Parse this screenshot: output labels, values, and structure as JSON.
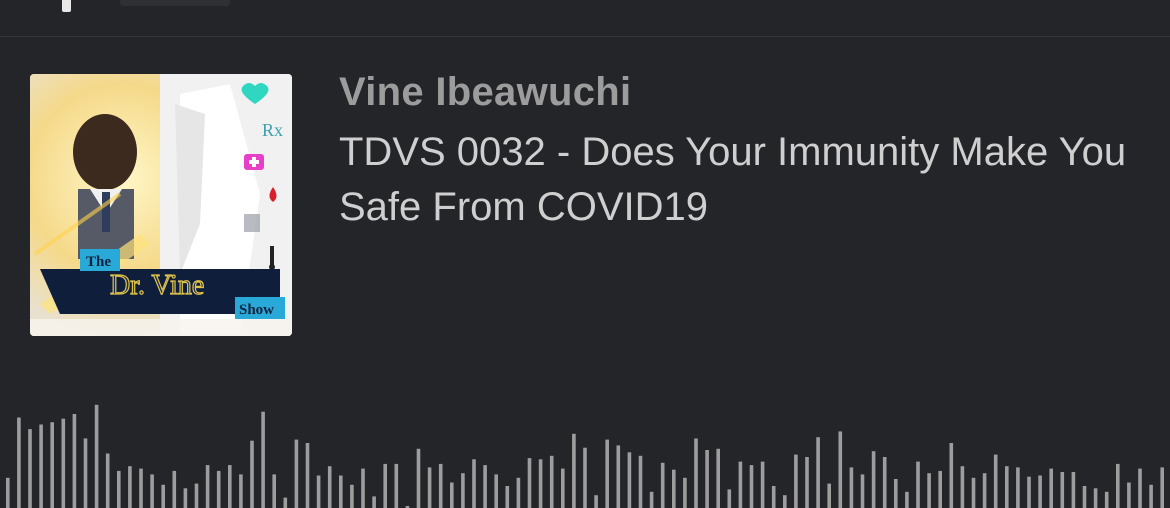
{
  "player": {
    "author": "Vine Ibeawuchi",
    "episode_title": "TDVS 0032 - Does Your Immunity Make You Safe From COVID19",
    "cover": {
      "alt": "The Dr. Vine Show cover art",
      "text_the": "The",
      "text_name": "Dr. Vine",
      "text_show": "Show",
      "icons": [
        "heart-pulse-icon",
        "rx-icon",
        "medkit-icon",
        "blood-drop-icon",
        "stethoscope-icon",
        "thermometer-icon"
      ]
    }
  },
  "waveform": {
    "bar_color": "#9d9d9d",
    "levels": [
      0.26,
      0.78,
      0.68,
      0.72,
      0.74,
      0.77,
      0.81,
      0.6,
      0.89,
      0.47,
      0.32,
      0.36,
      0.34,
      0.29,
      0.2,
      0.32,
      0.17,
      0.21,
      0.37,
      0.32,
      0.37,
      0.29,
      0.58,
      0.83,
      0.29,
      0.09,
      0.59,
      0.56,
      0.28,
      0.36,
      0.28,
      0.2,
      0.34,
      0.1,
      0.38,
      0.38,
      0.0,
      0.51,
      0.35,
      0.38,
      0.22,
      0.3,
      0.42,
      0.37,
      0.29,
      0.19,
      0.26,
      0.43,
      0.42,
      0.45,
      0.34,
      0.64,
      0.52,
      0.11,
      0.59,
      0.54,
      0.48,
      0.45,
      0.14,
      0.39,
      0.33,
      0.26,
      0.6,
      0.5,
      0.51,
      0.16,
      0.4,
      0.37,
      0.4,
      0.19,
      0.11,
      0.46,
      0.44,
      0.61,
      0.21,
      0.66,
      0.35,
      0.29,
      0.49,
      0.44,
      0.25,
      0.14,
      0.4,
      0.3,
      0.32,
      0.56,
      0.36,
      0.26,
      0.3,
      0.46,
      0.36,
      0.35,
      0.27,
      0.28,
      0.34,
      0.31,
      0.31,
      0.19,
      0.17,
      0.14,
      0.38,
      0.22,
      0.34,
      0.2,
      0.35,
      0.28,
      0.1,
      0.08,
      0.39,
      0.19,
      0.14,
      0.18,
      0.77,
      0.41
    ]
  }
}
